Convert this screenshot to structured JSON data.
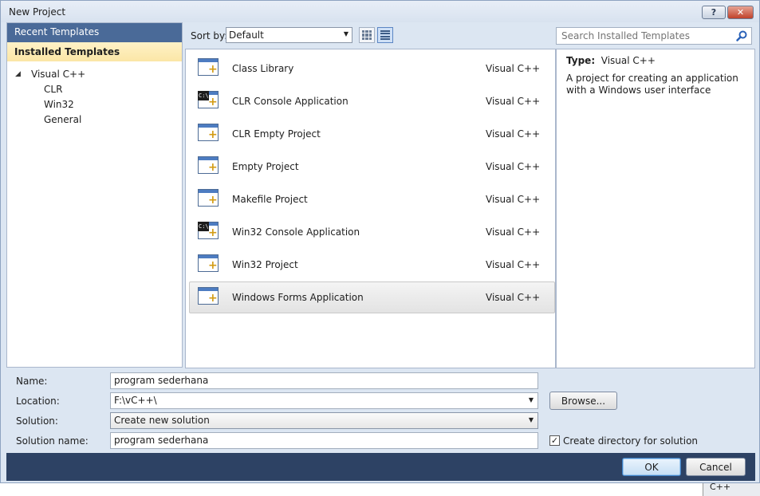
{
  "window": {
    "title": "New Project",
    "help_label": "?",
    "close_label": "✕"
  },
  "left_pane": {
    "recent_label": "Recent Templates",
    "installed_label": "Installed Templates",
    "tree": {
      "root_label": "Visual C++",
      "children": [
        "CLR",
        "Win32",
        "General"
      ]
    }
  },
  "toolbar": {
    "sort_label": "Sort by:",
    "sort_value": "Default"
  },
  "search": {
    "placeholder": "Search Installed Templates"
  },
  "templates": [
    {
      "name": "Class Library",
      "lang": "Visual C++",
      "icon": "class-library-icon"
    },
    {
      "name": "CLR Console Application",
      "lang": "Visual C++",
      "icon": "console-app-icon"
    },
    {
      "name": "CLR Empty Project",
      "lang": "Visual C++",
      "icon": "empty-project-icon"
    },
    {
      "name": "Empty Project",
      "lang": "Visual C++",
      "icon": "empty-project-icon"
    },
    {
      "name": "Makefile Project",
      "lang": "Visual C++",
      "icon": "makefile-project-icon"
    },
    {
      "name": "Win32 Console Application",
      "lang": "Visual C++",
      "icon": "console-app-icon"
    },
    {
      "name": "Win32 Project",
      "lang": "Visual C++",
      "icon": "win32-project-icon"
    },
    {
      "name": "Windows Forms Application",
      "lang": "Visual C++",
      "icon": "windows-forms-icon"
    }
  ],
  "selected_template_index": 7,
  "description": {
    "type_label": "Type:",
    "type_value": "Visual C++",
    "text": "A project for creating an application with a Windows user interface"
  },
  "form": {
    "name_label": "Name:",
    "name_value": "program sederhana",
    "location_label": "Location:",
    "location_value": "F:\\vC++\\",
    "solution_label": "Solution:",
    "solution_value": "Create new solution",
    "solution_name_label": "Solution name:",
    "solution_name_value": "program sederhana",
    "browse_label": "Browse...",
    "create_dir_label": "Create directory for solution",
    "create_dir_checked": true
  },
  "footer": {
    "ok_label": "OK",
    "cancel_label": "Cancel"
  },
  "background": {
    "strip_text": "C++"
  }
}
